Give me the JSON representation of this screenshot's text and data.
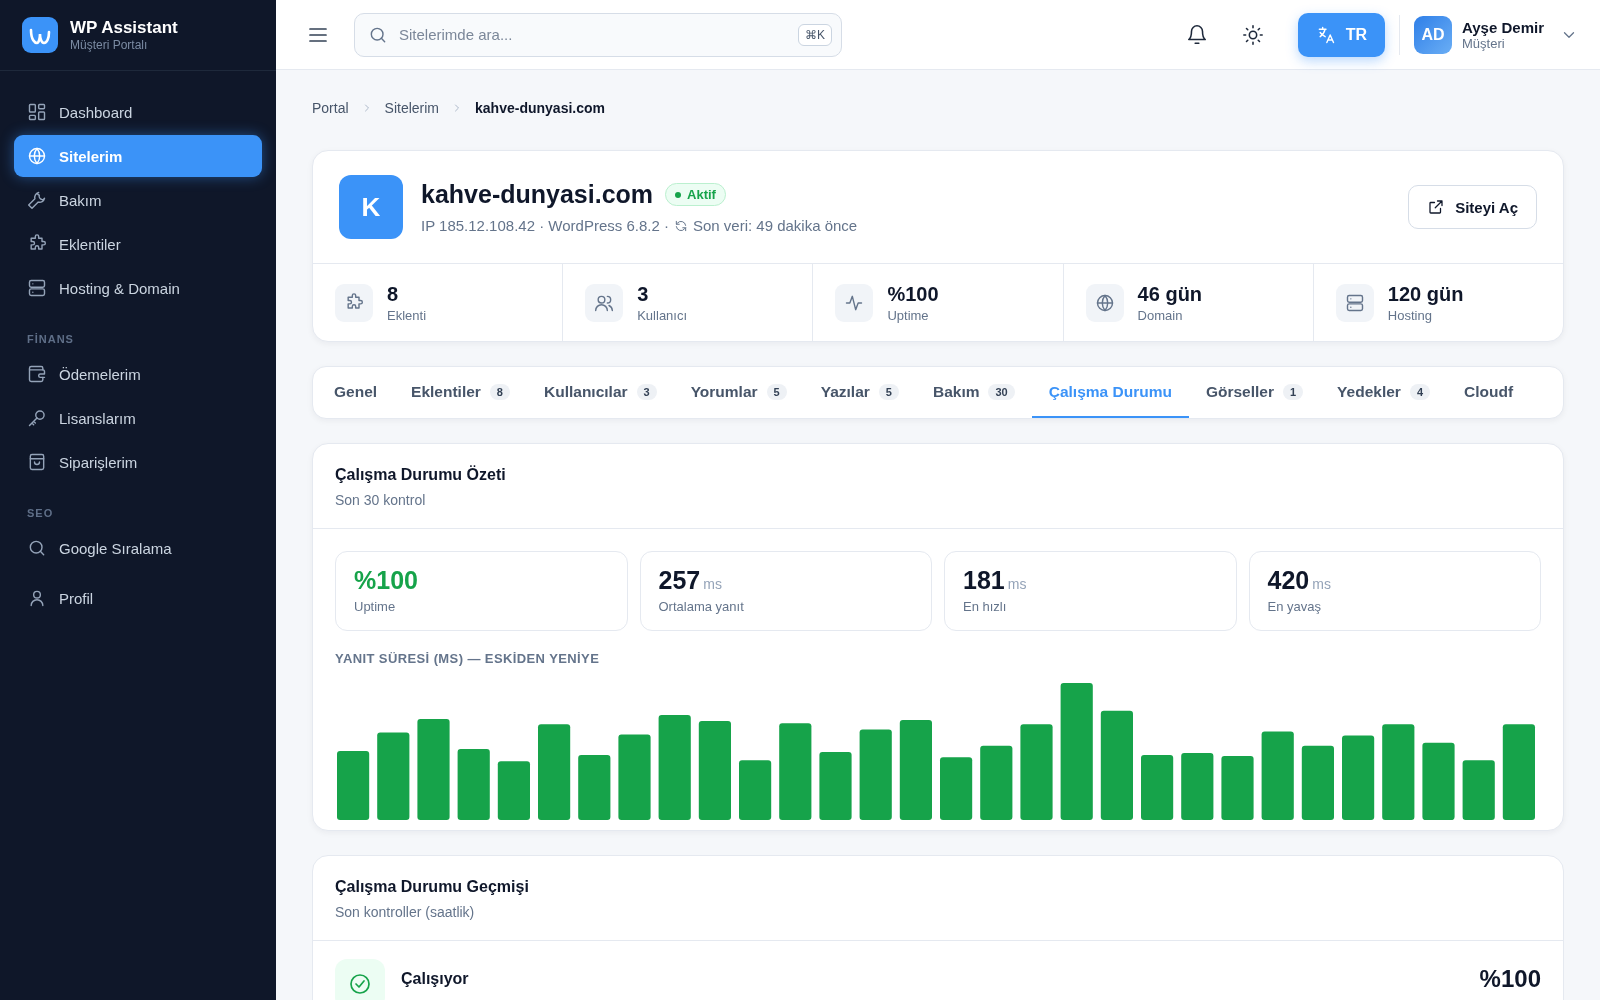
{
  "sidebar": {
    "brand": {
      "title": "WP Assistant",
      "subtitle": "Müşteri Portalı"
    },
    "sections": [
      {
        "items": [
          {
            "label": "Dashboard",
            "selected": false
          },
          {
            "label": "Sitelerim",
            "selected": true
          },
          {
            "label": "Bakım",
            "selected": false
          },
          {
            "label": "Eklentiler",
            "selected": false
          },
          {
            "label": "Hosting & Domain",
            "selected": false
          }
        ]
      },
      {
        "heading": "FİNANS",
        "items": [
          {
            "label": "Ödemelerim",
            "selected": false
          },
          {
            "label": "Lisanslarım",
            "selected": false
          },
          {
            "label": "Siparişlerim",
            "selected": false
          }
        ]
      },
      {
        "heading": "SEO",
        "items": [
          {
            "label": "Google Sıralama",
            "selected": false
          },
          {
            "label": "Profil",
            "selected": false
          }
        ]
      }
    ]
  },
  "header": {
    "search": {
      "placeholder": "Sitelerimde ara...",
      "shortcut": "⌘K"
    },
    "language": "TR",
    "user": {
      "initials": "AD",
      "name": "Ayşe Demir",
      "role": "Müşteri"
    }
  },
  "breadcrumb": [
    "Portal",
    "Sitelerim",
    "kahve-dunyasi.com"
  ],
  "site": {
    "letter": "K",
    "name": "kahve-dunyasi.com",
    "status": {
      "kind": "active",
      "label": "Aktif"
    },
    "meta": "IP 185.12.108.42 · WordPress 6.8.2 ·",
    "last_data": "Son veri: 49 dakika önce",
    "open_button": "Siteyi Aç",
    "stats": [
      {
        "value": "8",
        "label": "Eklenti"
      },
      {
        "value": "3",
        "label": "Kullanıcı"
      },
      {
        "value": "%100",
        "label": "Uptime"
      },
      {
        "value": "46 gün",
        "label": "Domain"
      },
      {
        "value": "120 gün",
        "label": "Hosting"
      }
    ]
  },
  "tabs": [
    {
      "label": "Genel",
      "selected": false
    },
    {
      "label": "Eklentiler",
      "count": "8",
      "selected": false
    },
    {
      "label": "Kullanıcılar",
      "count": "3",
      "selected": false
    },
    {
      "label": "Yorumlar",
      "count": "5",
      "selected": false
    },
    {
      "label": "Yazılar",
      "count": "5",
      "selected": false
    },
    {
      "label": "Bakım",
      "count": "30",
      "selected": false
    },
    {
      "label": "Çalışma Durumu",
      "selected": true
    },
    {
      "label": "Görseller",
      "count": "1",
      "selected": false
    },
    {
      "label": "Yedekler",
      "count": "4",
      "selected": false
    },
    {
      "label": "Cloudf",
      "selected": false
    }
  ],
  "summary": {
    "title": "Çalışma Durumu Özeti",
    "subtitle": "Son 30 kontrol",
    "metrics": [
      {
        "value": "%100",
        "label": "Uptime",
        "positive": true
      },
      {
        "value": "257",
        "unit": "ms",
        "label": "Ortalama yanıt",
        "positive": false
      },
      {
        "value": "181",
        "unit": "ms",
        "label": "En hızlı",
        "positive": false
      },
      {
        "value": "420",
        "unit": "ms",
        "label": "En yavaş",
        "positive": false
      }
    ],
    "chart_title": "YANIT SÜRESİ (MS) — ESKİDEN YENİYE"
  },
  "history": {
    "title": "Çalışma Durumu Geçmişi",
    "subtitle": "Son kontroller (saatlik)",
    "rows": [
      {
        "kind": "up",
        "label": "Çalışıyor",
        "value": "%100"
      }
    ]
  }
}
